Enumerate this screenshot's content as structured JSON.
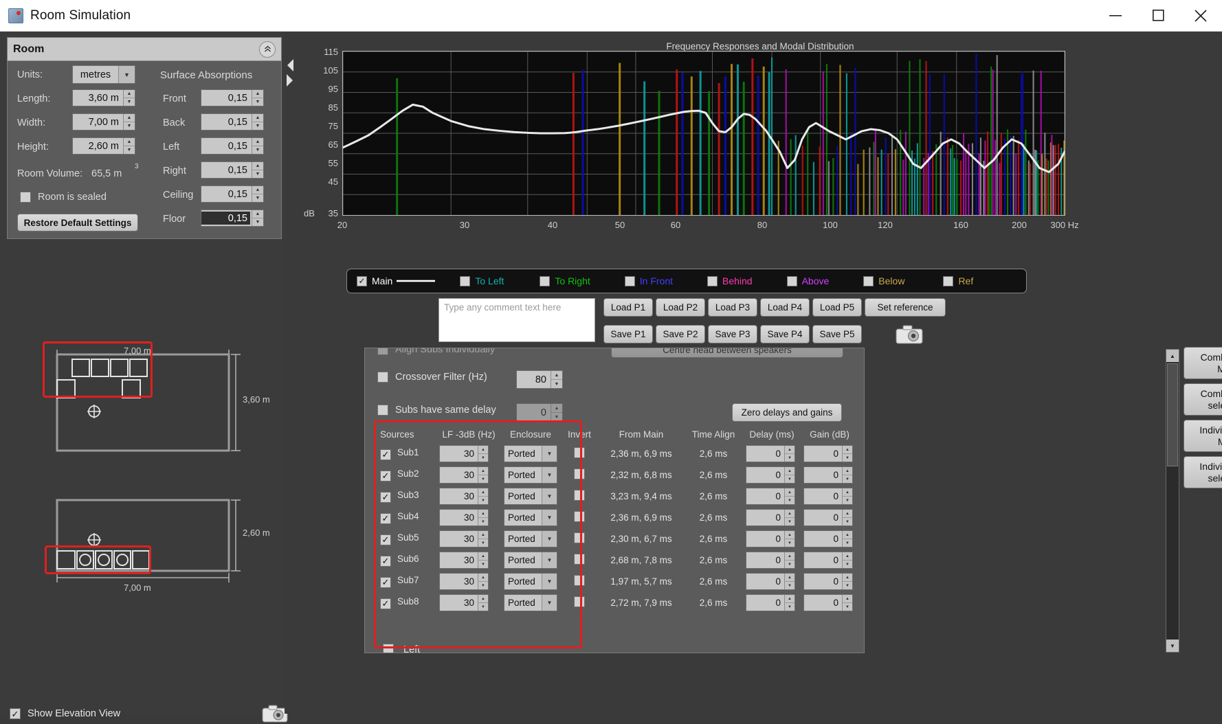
{
  "window": {
    "title": "Room Simulation",
    "icon": "app-icon",
    "minimize": "─",
    "maximize": "□",
    "close": "✕"
  },
  "room_panel": {
    "header": "Room",
    "collapse_icon": "chevrons-up-icon",
    "units_label": "Units:",
    "units_value": "metres",
    "length_label": "Length:",
    "length_value": "3,60 m",
    "width_label": "Width:",
    "width_value": "7,00 m",
    "height_label": "Height:",
    "height_value": "2,60 m",
    "volume_label": "Room Volume:",
    "volume_value": "65,5 m",
    "volume_exp": "3",
    "sealed_label": "Room is sealed",
    "sealed_checked": false,
    "restore_label": "Restore Default Settings",
    "absorptions_title": "Surface Absorptions",
    "absorptions": [
      {
        "label": "Front",
        "value": "0,15",
        "selected": false
      },
      {
        "label": "Back",
        "value": "0,15",
        "selected": false
      },
      {
        "label": "Left",
        "value": "0,15",
        "selected": false
      },
      {
        "label": "Right",
        "value": "0,15",
        "selected": false
      },
      {
        "label": "Ceiling",
        "value": "0,15",
        "selected": false
      },
      {
        "label": "Floor",
        "value": "0,15",
        "selected": true
      }
    ]
  },
  "plan_view": {
    "width_top": "7,00 m",
    "depth_right": "3,60 m"
  },
  "elevation_view": {
    "height_right": "2,60 m",
    "width_bottom": "7,00 m"
  },
  "footer": {
    "show_elevation_label": "Show Elevation View",
    "show_elevation_checked": true,
    "camera_icon": "camera-icon"
  },
  "chart_data": {
    "type": "line",
    "title": "Frequency Responses and Modal Distribution",
    "xlabel": "Hz",
    "ylabel": "dB",
    "y_axis_unit": "dB",
    "xlim": [
      20,
      300
    ],
    "ylim": [
      35,
      115
    ],
    "x_scale": "log",
    "yticks": [
      115,
      105,
      95,
      85,
      75,
      65,
      55,
      45,
      35
    ],
    "xticks": [
      20,
      30,
      40,
      50,
      60,
      80,
      100,
      120,
      160,
      200,
      300
    ],
    "x_end_label": "300 Hz",
    "grid": true,
    "series": [
      {
        "name": "Main",
        "color": "#e9e9e9",
        "x": [
          20,
          21,
          22,
          23,
          24,
          25,
          26,
          27,
          28,
          30,
          32,
          34,
          36,
          38,
          40,
          42,
          44,
          46,
          47,
          48,
          49,
          50,
          52,
          54,
          56,
          58,
          60,
          62,
          64,
          66,
          68,
          70,
          72,
          74,
          76,
          78,
          80,
          82,
          84,
          86,
          88,
          90,
          92,
          94,
          96,
          98,
          100,
          103,
          106,
          109,
          112,
          115,
          118,
          121,
          124,
          128,
          132,
          136,
          140,
          145,
          150,
          155,
          160,
          165,
          170,
          175,
          180,
          185,
          190,
          196,
          202,
          208,
          215,
          222,
          230,
          238,
          246,
          255,
          264,
          273,
          283,
          293,
          300
        ],
        "y": [
          68,
          71,
          74,
          78,
          82,
          86,
          89,
          88,
          85,
          81,
          78.5,
          77,
          76.2,
          75.6,
          75.2,
          75.0,
          75.0,
          75.1,
          75.3,
          75.6,
          76,
          76.4,
          77,
          77.8,
          78.6,
          79.5,
          80.4,
          81.3,
          82.2,
          83.1,
          84,
          84.8,
          85.5,
          85.9,
          86,
          85,
          80,
          76,
          75.5,
          78,
          82,
          84.5,
          84,
          82,
          79,
          76,
          72,
          66,
          58,
          62,
          72,
          78,
          80,
          78,
          76,
          74,
          72,
          74,
          76,
          77,
          76.5,
          75,
          72,
          66,
          60,
          58,
          62,
          66,
          70,
          72,
          70,
          66,
          62,
          58,
          62,
          68,
          72,
          70,
          64,
          58,
          56,
          60,
          66,
          70
        ]
      }
    ],
    "modal_lines": {
      "description": "vertical modal resonance lines colored by axis",
      "colors": [
        "#0d7a0d",
        "#b81414",
        "#0b0bb0",
        "#b08a10",
        "#0f9a9a",
        "#a80fa8",
        "#8a8a8a"
      ],
      "count_approx": 180
    },
    "legend": {
      "position": "below-plot",
      "entries": [
        {
          "label": "Main",
          "color": "#ffffff",
          "checked": true,
          "has_line": true
        },
        {
          "label": "To Left",
          "color": "#17b0b0",
          "checked": false,
          "has_line": false
        },
        {
          "label": "To Right",
          "color": "#13c013",
          "checked": false,
          "has_line": false
        },
        {
          "label": "In Front",
          "color": "#4040ff",
          "checked": false,
          "has_line": false
        },
        {
          "label": "Behind",
          "color": "#ff3ab0",
          "checked": false,
          "has_line": false
        },
        {
          "label": "Above",
          "color": "#d040ff",
          "checked": false,
          "has_line": false
        },
        {
          "label": "Below",
          "color": "#c9a84a",
          "checked": false,
          "has_line": false
        },
        {
          "label": "Ref",
          "color": "#c9a84a",
          "checked": false,
          "has_line": false
        }
      ]
    }
  },
  "comment": {
    "placeholder": "Type any comment text here",
    "value": ""
  },
  "preset_buttons": {
    "load": [
      "Load P1",
      "Load P2",
      "Load P3",
      "Load P4",
      "Load P5"
    ],
    "save": [
      "Save P1",
      "Save P2",
      "Save P3",
      "Save P4",
      "Save P5"
    ],
    "set_reference": "Set reference",
    "camera_icon": "camera-icon"
  },
  "settings": {
    "align_subs_label": "Align Subs Individually",
    "align_subs_checked": false,
    "centre_head_label": "Centre head between speakers",
    "crossover_label": "Crossover Filter (Hz)",
    "crossover_value": "80",
    "crossover_checked": false,
    "same_delay_label": "Subs have same delay",
    "same_delay_value": "0",
    "same_delay_checked": false,
    "zero_delays_label": "Zero delays and gains"
  },
  "sources_table": {
    "headers": [
      "Sources",
      "LF -3dB (Hz)",
      "Enclosure",
      "Invert",
      "From Main",
      "Time Align",
      "Delay (ms)",
      "Gain (dB)"
    ],
    "rows": [
      {
        "name": "Sub1",
        "enabled": true,
        "lf": "30",
        "enclosure": "Ported",
        "invert": false,
        "from_main": "2,36 m, 6,9 ms",
        "time_align": "2,6 ms",
        "delay": "0",
        "gain": "0"
      },
      {
        "name": "Sub2",
        "enabled": true,
        "lf": "30",
        "enclosure": "Ported",
        "invert": false,
        "from_main": "2,32 m, 6,8 ms",
        "time_align": "2,6 ms",
        "delay": "0",
        "gain": "0"
      },
      {
        "name": "Sub3",
        "enabled": true,
        "lf": "30",
        "enclosure": "Ported",
        "invert": false,
        "from_main": "3,23 m, 9,4 ms",
        "time_align": "2,6 ms",
        "delay": "0",
        "gain": "0"
      },
      {
        "name": "Sub4",
        "enabled": true,
        "lf": "30",
        "enclosure": "Ported",
        "invert": false,
        "from_main": "2,36 m, 6,9 ms",
        "time_align": "2,6 ms",
        "delay": "0",
        "gain": "0"
      },
      {
        "name": "Sub5",
        "enabled": true,
        "lf": "30",
        "enclosure": "Ported",
        "invert": false,
        "from_main": "2,30 m, 6,7 ms",
        "time_align": "2,6 ms",
        "delay": "0",
        "gain": "0"
      },
      {
        "name": "Sub6",
        "enabled": true,
        "lf": "30",
        "enclosure": "Ported",
        "invert": false,
        "from_main": "2,68 m, 7,8 ms",
        "time_align": "2,6 ms",
        "delay": "0",
        "gain": "0"
      },
      {
        "name": "Sub7",
        "enabled": true,
        "lf": "30",
        "enclosure": "Ported",
        "invert": false,
        "from_main": "1,97 m, 5,7 ms",
        "time_align": "2,6 ms",
        "delay": "0",
        "gain": "0"
      },
      {
        "name": "Sub8",
        "enabled": true,
        "lf": "30",
        "enclosure": "Ported",
        "invert": false,
        "from_main": "2,72 m, 7,9 ms",
        "time_align": "2,6 ms",
        "delay": "0",
        "gain": "0"
      }
    ],
    "partial_next_row": "Left"
  },
  "response_buttons": [
    "Combined response at\nMain mic Posn",
    "Combined response at\nselected mic posns",
    "Individual responses at\nMain mic posn",
    "Individual responses at\nselected mic posns"
  ],
  "response_buttons_lines": [
    [
      "Combined response at",
      "Main mic Posn"
    ],
    [
      "Combined response at",
      "selected mic posns"
    ],
    [
      "Individual responses at",
      "Main mic posn"
    ],
    [
      "Individual responses at",
      "selected mic posns"
    ]
  ],
  "scrollbar": {
    "up_icon": "chevron-up-icon",
    "down_icon": "chevron-down-icon"
  }
}
